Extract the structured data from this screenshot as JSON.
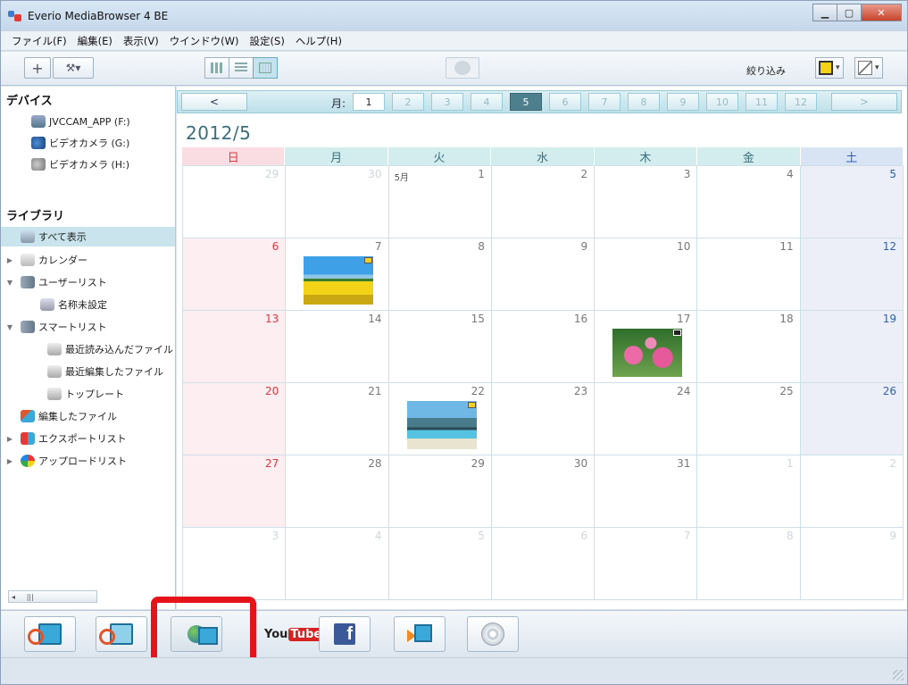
{
  "window": {
    "title": "Everio MediaBrowser 4 BE"
  },
  "menu": [
    "ファイル(F)",
    "編集(E)",
    "表示(V)",
    "ウインドウ(W)",
    "設定(S)",
    "ヘルプ(H)"
  ],
  "toolbar": {
    "add_label": "+",
    "tool_label": "⚒▾",
    "filter_label": "絞り込み"
  },
  "sidebar": {
    "devices_heading": "デバイス",
    "devices": [
      {
        "label": "JVCCAM_APP (F:)",
        "icon": "drive-icon"
      },
      {
        "label": "ビデオカメラ (G:)",
        "icon": "camera-icon"
      },
      {
        "label": "ビデオカメラ (H:)",
        "icon": "camera-icon"
      }
    ],
    "library_heading": "ライブラリ",
    "library": [
      {
        "label": "すべて表示",
        "selected": true
      },
      {
        "label": "カレンダー"
      },
      {
        "label": "ユーザーリスト"
      },
      {
        "label": "名称未設定"
      },
      {
        "label": "スマートリスト"
      },
      {
        "label": "最近読み込んだファイル"
      },
      {
        "label": "最近編集したファイル"
      },
      {
        "label": "トップレート"
      },
      {
        "label": "編集したファイル"
      },
      {
        "label": "エクスポートリスト"
      },
      {
        "label": "アップロードリスト"
      }
    ]
  },
  "calendar": {
    "prev_label": "<",
    "next_label": ">",
    "month_prefix": "月:",
    "months": [
      "1",
      "2",
      "3",
      "4",
      "5",
      "6",
      "7",
      "8",
      "9",
      "10",
      "11",
      "12"
    ],
    "current_month": "5",
    "year_month": "2012/5",
    "weekdays": [
      "日",
      "月",
      "火",
      "水",
      "木",
      "金",
      "土"
    ],
    "month_label": "5月",
    "weeks": [
      [
        "29",
        "30",
        "1",
        "2",
        "3",
        "4",
        "5"
      ],
      [
        "6",
        "7",
        "8",
        "9",
        "10",
        "11",
        "12"
      ],
      [
        "13",
        "14",
        "15",
        "16",
        "17",
        "18",
        "19"
      ],
      [
        "20",
        "21",
        "22",
        "23",
        "24",
        "25",
        "26"
      ],
      [
        "27",
        "28",
        "29",
        "30",
        "31",
        "1",
        "2"
      ],
      [
        "3",
        "4",
        "5",
        "6",
        "7",
        "8",
        "9"
      ]
    ],
    "thumbnails": [
      {
        "date": "7",
        "kind": "field"
      },
      {
        "date": "17",
        "kind": "flower"
      },
      {
        "date": "22",
        "kind": "beach"
      }
    ]
  },
  "bottom_toolbar": {
    "youtube_you": "You",
    "youtube_tube": "Tube",
    "facebook_letter": "f",
    "highlight_color": "#e5141b"
  }
}
